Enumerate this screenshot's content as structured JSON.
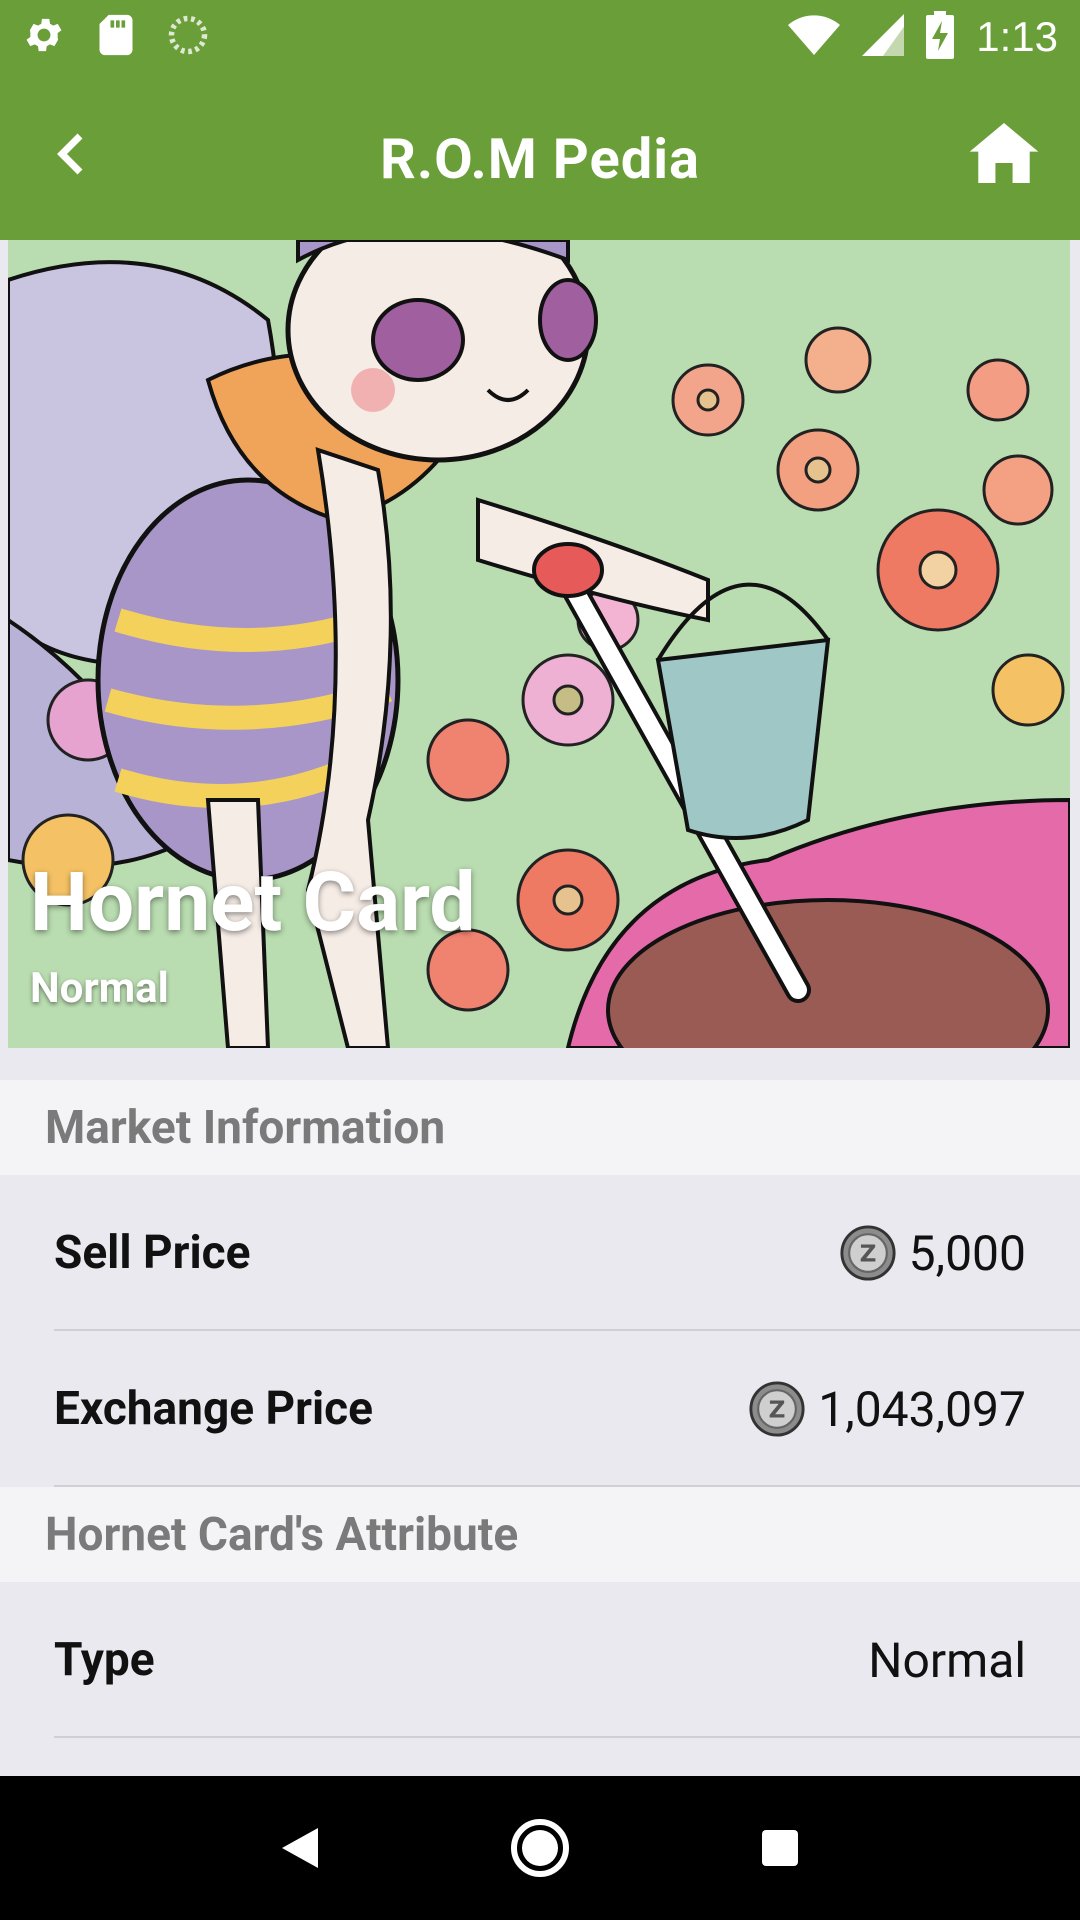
{
  "status_bar": {
    "time": "1:13",
    "icons": [
      "gear-icon",
      "sd-card-icon",
      "sync-icon",
      "wifi-icon",
      "signal-icon",
      "battery-charging-icon"
    ]
  },
  "app_bar": {
    "title": "R.O.M Pedia",
    "back_icon": "chevron-left-icon",
    "home_icon": "home-icon"
  },
  "hero": {
    "title": "Hornet Card",
    "subtitle": "Normal"
  },
  "market": {
    "header": "Market Information",
    "rows": [
      {
        "label": "Sell Price",
        "value": "5,000",
        "icon": "zeny-coin-icon"
      },
      {
        "label": "Exchange Price",
        "value": "1,043,097",
        "icon": "zeny-coin-icon"
      }
    ]
  },
  "attributes": {
    "header": "Hornet Card's Attribute",
    "rows": [
      {
        "label": "Type",
        "value": "Normal"
      }
    ]
  },
  "nav_bar": {
    "icons": [
      "nav-back-icon",
      "nav-home-icon",
      "nav-recents-icon"
    ]
  },
  "colors": {
    "primary": "#6a9e38",
    "background": "#e9e9ef",
    "section_header_bg": "#f4f4f6",
    "section_header_text": "#7a7a7a"
  }
}
